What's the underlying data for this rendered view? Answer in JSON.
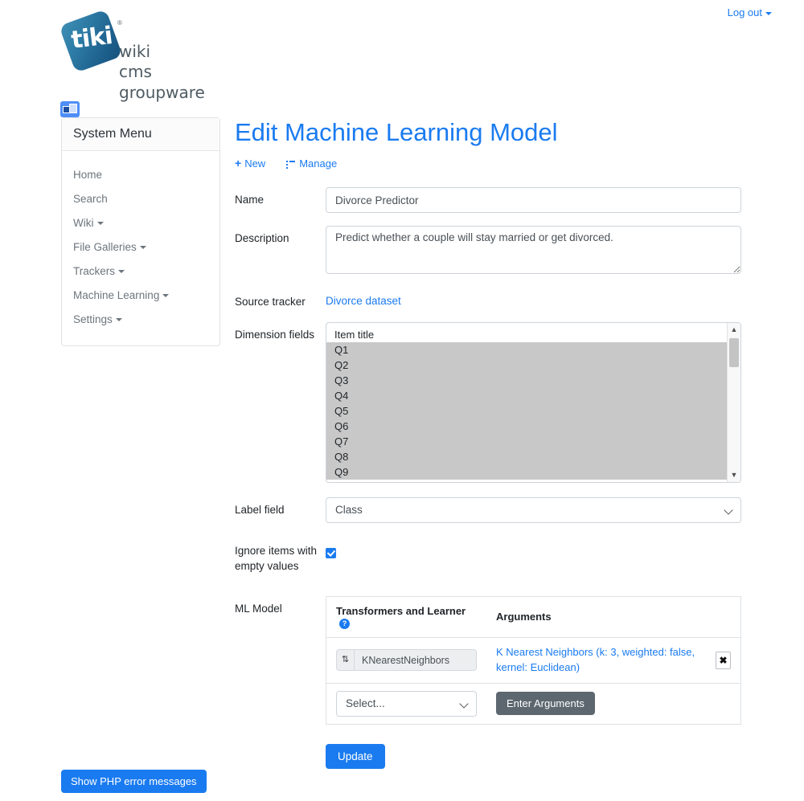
{
  "topbar": {
    "logout_label": "Log out"
  },
  "logo": {
    "mark_text": "tiki",
    "registered": "®",
    "line1": "wiki",
    "line2": "cms",
    "line3": "groupware"
  },
  "sidebar": {
    "toggle_icon": "panel-toggle-icon",
    "title": "System Menu",
    "items": [
      {
        "label": "Home",
        "has_caret": false
      },
      {
        "label": "Search",
        "has_caret": false
      },
      {
        "label": "Wiki",
        "has_caret": true
      },
      {
        "label": "File Galleries",
        "has_caret": true
      },
      {
        "label": "Trackers",
        "has_caret": true
      },
      {
        "label": "Machine Learning",
        "has_caret": true
      },
      {
        "label": "Settings",
        "has_caret": true
      }
    ]
  },
  "main": {
    "title": "Edit Machine Learning Model",
    "actions": [
      {
        "label": "New",
        "icon": "plus-icon"
      },
      {
        "label": "Manage",
        "icon": "list-icon"
      }
    ],
    "form": {
      "name": {
        "label": "Name",
        "value": "Divorce Predictor",
        "placeholder": ""
      },
      "description": {
        "label": "Description",
        "value": "Predict whether a couple will stay married or get divorced.",
        "placeholder": ""
      },
      "source_tracker": {
        "label": "Source tracker",
        "link_text": "Divorce dataset"
      },
      "dimension_fields": {
        "label": "Dimension fields",
        "options": [
          {
            "label": "Item title",
            "selected": false
          },
          {
            "label": "Q1",
            "selected": true
          },
          {
            "label": "Q2",
            "selected": true
          },
          {
            "label": "Q3",
            "selected": true
          },
          {
            "label": "Q4",
            "selected": true
          },
          {
            "label": "Q5",
            "selected": true
          },
          {
            "label": "Q6",
            "selected": true
          },
          {
            "label": "Q7",
            "selected": true
          },
          {
            "label": "Q8",
            "selected": true
          },
          {
            "label": "Q9",
            "selected": true
          }
        ],
        "scroll_up_icon": "chevron-up-icon",
        "scroll_down_icon": "chevron-down-icon"
      },
      "label_field": {
        "label": "Label field",
        "value": "Class"
      },
      "ignore_empty": {
        "label": "Ignore items with empty values",
        "checked": true
      },
      "ml_model": {
        "label": "ML Model",
        "columns": [
          "Transformers and Learner",
          "Arguments"
        ],
        "help_badge": "?",
        "rows": [
          {
            "drag_handle": "drag-handle-icon",
            "learner": "KNearestNeighbors",
            "arguments": "K Nearest Neighbors (k: 3, weighted: false, kernel: Euclidean)",
            "delete_label": "✖"
          }
        ],
        "add_select_value": "Select...",
        "enter_arguments_label": "Enter Arguments"
      },
      "update_label": "Update"
    }
  },
  "footer": {
    "php_errors_label": "Show PHP error messages"
  },
  "colors": {
    "link_blue": "#1a7bf0",
    "primary": "#1a7bf0",
    "grey_button": "#5d6770",
    "selected_row": "#c8c8c8"
  }
}
